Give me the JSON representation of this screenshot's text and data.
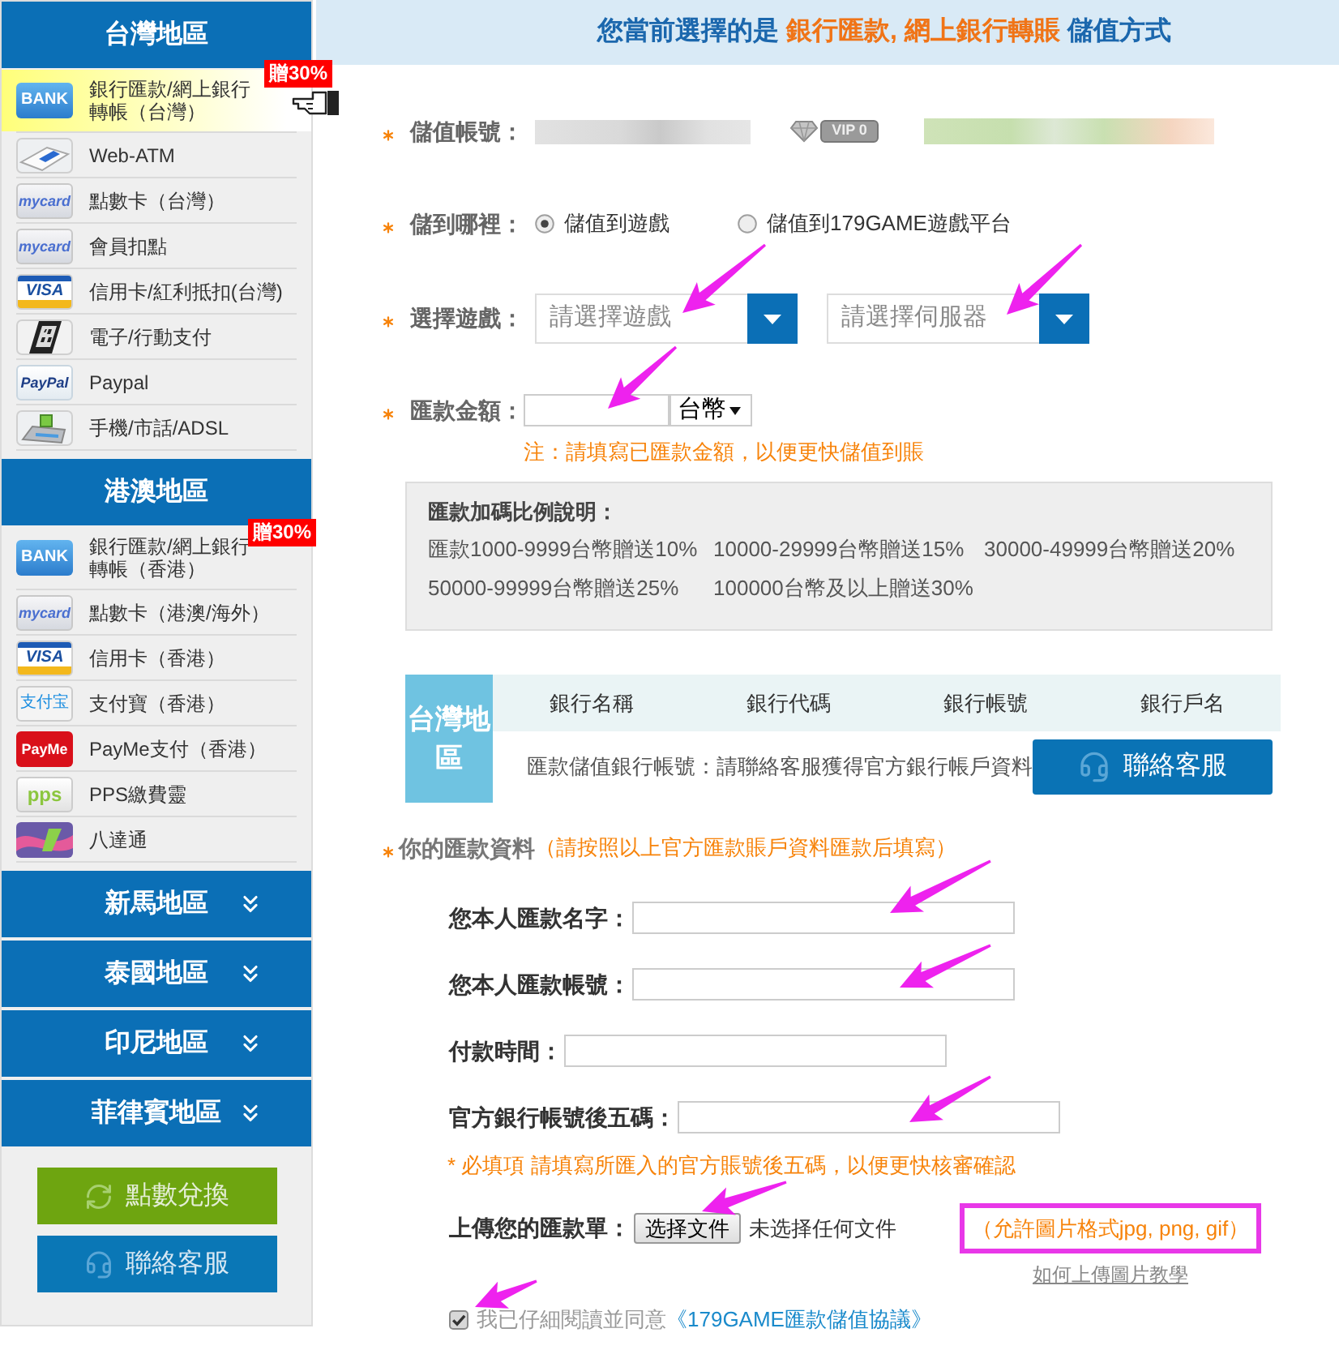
{
  "sidebar": {
    "regions": [
      {
        "title": "台灣地區",
        "expanded": true,
        "items": [
          {
            "label": "銀行匯款/網上銀行轉帳（台灣）",
            "selected": true,
            "badge": "贈30%",
            "icon": {
              "kind": "bank",
              "text": "BANK"
            }
          },
          {
            "label": "Web-ATM",
            "selected": false,
            "icon": {
              "kind": "card-reader"
            }
          },
          {
            "label": "點數卡（台灣）",
            "selected": false,
            "icon": {
              "kind": "mycard",
              "text": "mycard"
            }
          },
          {
            "label": "會員扣點",
            "selected": false,
            "icon": {
              "kind": "mycard",
              "text": "mycard"
            }
          },
          {
            "label": "信用卡/紅利抵扣(台灣)",
            "selected": false,
            "icon": {
              "kind": "visa",
              "text": "VISA"
            }
          },
          {
            "label": "電子/行動支付",
            "selected": false,
            "icon": {
              "kind": "qr-phone"
            }
          },
          {
            "label": "Paypal",
            "selected": false,
            "icon": {
              "kind": "paypal",
              "text": "PayPal"
            }
          },
          {
            "label": "手機/市話/ADSL",
            "selected": false,
            "icon": {
              "kind": "terminal"
            }
          }
        ]
      },
      {
        "title": "港澳地區",
        "expanded": true,
        "items": [
          {
            "label": "銀行匯款/網上銀行轉帳（香港）",
            "selected": false,
            "badge": "贈30%",
            "icon": {
              "kind": "bank",
              "text": "BANK"
            }
          },
          {
            "label": "點數卡（港澳/海外）",
            "selected": false,
            "icon": {
              "kind": "mycard",
              "text": "mycard"
            }
          },
          {
            "label": "信用卡（香港）",
            "selected": false,
            "icon": {
              "kind": "visa",
              "text": "VISA"
            }
          },
          {
            "label": "支付寶（香港）",
            "selected": false,
            "icon": {
              "kind": "alipay",
              "text": "支付宝"
            }
          },
          {
            "label": "PayMe支付（香港）",
            "selected": false,
            "icon": {
              "kind": "payme",
              "text": "PayMe"
            }
          },
          {
            "label": "PPS繳費靈",
            "selected": false,
            "icon": {
              "kind": "pps",
              "text": "pps"
            }
          },
          {
            "label": "八達通",
            "selected": false,
            "icon": {
              "kind": "transit-card"
            }
          }
        ]
      },
      {
        "title": "新馬地區",
        "expanded": false
      },
      {
        "title": "泰國地區",
        "expanded": false
      },
      {
        "title": "印尼地區",
        "expanded": false
      },
      {
        "title": "菲律賓地區",
        "expanded": false
      }
    ],
    "buttons": [
      {
        "label": "點數兌換",
        "kind": "exchange"
      },
      {
        "label": "聯絡客服",
        "kind": "support"
      }
    ]
  },
  "header": {
    "prefix": "您當前選擇的是",
    "highlight": "銀行匯款, 網上銀行轉賬",
    "suffix": "儲值方式"
  },
  "form": {
    "rows": [
      {
        "kind": "account",
        "label": "儲值帳號：",
        "required": true,
        "vip": "VIP 0"
      },
      {
        "kind": "radio",
        "label": "儲到哪裡：",
        "required": true,
        "options": [
          {
            "label": "儲值到遊戲",
            "selected": true
          },
          {
            "label": "儲值到179GAME遊戲平台",
            "selected": false
          }
        ]
      },
      {
        "kind": "selects",
        "label": "選擇遊戲：",
        "required": true,
        "selects": [
          {
            "placeholder": "請選擇遊戲"
          },
          {
            "placeholder": "請選擇伺服器"
          }
        ]
      },
      {
        "kind": "amount",
        "label": "匯款金額：",
        "required": true,
        "currency": "台幣",
        "note": "注：請填寫已匯款金額，以便更快儲值到賬"
      }
    ]
  },
  "bonus_info": {
    "title": "匯款加碼比例說明：",
    "tiers": [
      "匯款1000-9999台幣贈送10%",
      "10000-29999台幣贈送15%",
      "30000-49999台幣贈送20%",
      "50000-99999台幣贈送25%",
      "100000台幣及以上贈送30%"
    ]
  },
  "bank_table": {
    "region": "台灣地區",
    "columns": [
      "銀行名稱",
      "銀行代碼",
      "銀行帳號",
      "銀行戶名"
    ],
    "note": "匯款儲值銀行帳號：請聯絡客服獲得官方銀行帳戶資料",
    "button": "聯絡客服"
  },
  "remittance": {
    "title": "你的匯款資料",
    "required": true,
    "hint": "（請按照以上官方匯款賬戶資料匯款后填寫）",
    "fields": [
      {
        "label": "您本人匯款名字："
      },
      {
        "label": "您本人匯款帳號："
      },
      {
        "label": "付款時間："
      },
      {
        "label": "官方銀行帳號後五碼："
      }
    ],
    "note": "* 必填項 請填寫所匯入的官方賬號後五碼，以便更快核審確認",
    "upload": {
      "label": "上傳您的匯款單：",
      "button": "选择文件",
      "status": "未选择任何文件",
      "formats": "（允許圖片格式jpg, png, gif）",
      "help_link": "如何上傳圖片教學"
    },
    "agreement": {
      "checked": true,
      "text": "我已仔細閱讀並同意",
      "link": "《179GAME匯款儲值協議》"
    }
  }
}
